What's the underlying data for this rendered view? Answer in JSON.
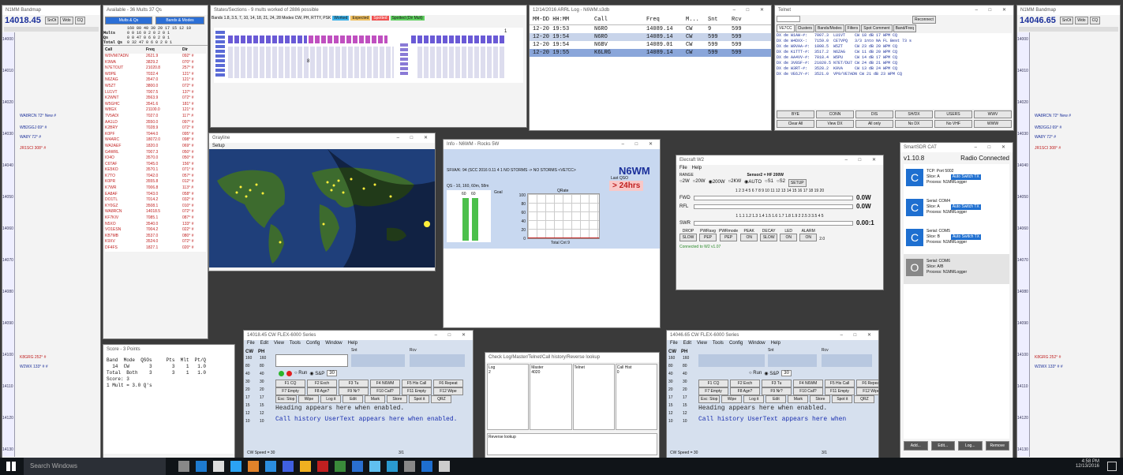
{
  "left_bandmap": {
    "title": "N1MM Bandmap",
    "freq": "14018.45",
    "buttons": [
      "SnOt",
      "Wdo",
      "CQ"
    ],
    "ticks": [
      "14000",
      "14010",
      "14020",
      "14030",
      "14040",
      "14050",
      "14060",
      "14070",
      "14080",
      "14090",
      "14100",
      "14110",
      "14120",
      "14130"
    ],
    "spots": [
      {
        "text": "WA8RCN 72° New #",
        "red": false
      },
      {
        "text": "WB2GGJ 69° #",
        "red": false
      },
      {
        "text": "WA8Y 72° #",
        "red": false
      },
      {
        "text": "JR1SCI 308° #",
        "red": true
      },
      {
        "text": "K8GRG 252° #",
        "red": true
      },
      {
        "text": "W2WX 133° # #",
        "red": false
      }
    ]
  },
  "available": {
    "title": "Available - 36 Mults 37 Qs",
    "buttons": [
      "Mults & Qs",
      "Bands & Modes"
    ],
    "header": "160 80 40 30 20 17 15 12 10",
    "rows": [
      {
        "label": "Mults",
        "vals": "0 0 16 0 2 0 2 0 1"
      },
      {
        "label": "Qs",
        "vals": "0 0 47 0 6 0 2 0 1"
      },
      {
        "label": "Total Qs",
        "vals": "0 32 47 0 6 0 2 0 1"
      }
    ],
    "list_headers": [
      "Call",
      "Freq",
      "Dir"
    ],
    "list": [
      [
        "W9VM/7ADN",
        "2621.9",
        "092° #"
      ],
      [
        "K9WA",
        "3829.2",
        "070° #"
      ],
      [
        "N7ETOUT",
        "21020.8",
        "257° #"
      ],
      [
        "W0PE",
        "7032.4",
        "121° #"
      ],
      [
        "N6ZAG",
        "3547.0",
        "121° #"
      ],
      [
        "W5ZT",
        "3800.0",
        "072° #"
      ],
      [
        "LU1VT",
        "7007.5",
        "137° #"
      ],
      [
        "K2WNT",
        "3563.9",
        "072° #"
      ],
      [
        "W5GHC",
        "3541.6",
        "181° #"
      ],
      [
        "W8GX",
        "21100.0",
        "121° #"
      ],
      [
        "7V5ADI",
        "7027.0",
        "117° #"
      ],
      [
        "AA1LD",
        "3550.0",
        "097° #"
      ],
      [
        "K2BRY",
        "7028.9",
        "072° #"
      ],
      [
        "K0PF",
        "7044.0",
        "095° #"
      ],
      [
        "W4ARC",
        "18072.0",
        "098° #"
      ],
      [
        "WA2AEF",
        "1820.0",
        "069° #"
      ],
      [
        "G4WRL",
        "7007.3",
        "050° #"
      ],
      [
        "IO4O",
        "3570.0",
        "050° #"
      ],
      [
        "C6TAF",
        "7045.0",
        "156° #"
      ],
      [
        "KE5KO",
        "3570.1",
        "071° #"
      ],
      [
        "K7TO",
        "7042.0",
        "057° #"
      ],
      [
        "K0PR",
        "3555.8",
        "012° #"
      ],
      [
        "K7WR",
        "7006.8",
        "113° #"
      ],
      [
        "EA8AF",
        "7043.0",
        "058° #"
      ],
      [
        "DO1TL",
        "7014.2",
        "032° #"
      ],
      [
        "KY0GZ",
        "3508.1",
        "010° #"
      ],
      [
        "WA8RCN",
        "14018.5",
        "072° #"
      ],
      [
        "KF7KIV",
        "7085.1",
        "087° #"
      ],
      [
        "N5XO",
        "3540.0",
        "133° #"
      ],
      [
        "VO1ESN",
        "7004.2",
        "022° #"
      ],
      [
        "KB7MB",
        "3537.0",
        "080° #"
      ],
      [
        "K9XV",
        "3524.0",
        "072° #"
      ],
      [
        "DF4FS",
        "1827.1",
        "020° #"
      ]
    ]
  },
  "states": {
    "title": "States/Sections - 9 mults worked of 2886 possible",
    "filter": "Bands 1.8, 3.5, 7, 10, 14, 18, 21, 24, 28 Modes CW, PH, RTTY, PSK",
    "legend": [
      "Worked",
      "Expected",
      "Spotted",
      "Spotted (Dir Mult)"
    ],
    "count": "8",
    "count2": "1"
  },
  "log": {
    "title": "12/14/2016 ARRL Log - N6WM.s3db",
    "headers": [
      "MM-DD HH:MM",
      "Call",
      "Freq",
      "M...",
      "Snt",
      "Rcv"
    ],
    "rows": [
      [
        "12-20 19:53",
        "N6RO",
        "14089.14",
        "CW",
        "9",
        "599"
      ],
      [
        "12-20 19:54",
        "N6RO",
        "14089.14",
        "CW",
        "599",
        "599"
      ],
      [
        "12-20 19:54",
        "N6BV",
        "14089.01",
        "CW",
        "599",
        "599"
      ],
      [
        "12-20 19:55",
        "K6LRG",
        "14089.14",
        "CW",
        "599",
        "599"
      ]
    ]
  },
  "telnet": {
    "title": "Telnet",
    "reconnect": "Reconnect",
    "tabs": [
      "VE7CC",
      "Clusters",
      "Bands/Modes",
      "Filters",
      "Spot Comment",
      "Band/Freq"
    ],
    "rows": [
      "DX de W1AW-#:   7007.3  LU1VT    CW 18 dB 17 WPM CQ",
      "DX de W4DXX-:   7159.0  CE7VPQ   3/3 into NA FL Best 73 s",
      "DX de W9VAA-#:  1808.5  W5ZT     CW 23 dB 20 WPM CQ",
      "DX de K1TTT-#:  3517.2  N6ZAG    CW 11 dB 20 WPM CQ",
      "DX de AA4VV-#:  7018.4  W5PU     CW 14 dB 17 WPM CQ",
      "DX de 3V8SF-#:  21020.5 N7ET/DU7 CW 24 dB 21 WPM CQ",
      "DX de W3RT-#:   3528.2  K9VA     CW 13 dB 24 WPM CQ",
      "DX de VE6JY-#:  3521.0  VP9/VE7ADN CW 21 dB 23 WPM CQ"
    ],
    "buttons_r1": [
      "BYE",
      "CONN",
      "DIS",
      "SH/DX",
      "USERS",
      "WWV"
    ],
    "buttons_r2": [
      "Clear All",
      "View DX",
      "All only",
      "No DX",
      "No VHF",
      "WWW"
    ]
  },
  "right_bandmap": {
    "title": "N1MM Bandmap",
    "freq": "14046.65",
    "buttons": [
      "SnOt",
      "Wdo",
      "CQ"
    ],
    "ticks": [
      "14000",
      "14010",
      "14020",
      "14030",
      "14040",
      "14050",
      "14060",
      "14070",
      "14080",
      "14090",
      "14100",
      "14110",
      "14120",
      "14130"
    ],
    "spots": [
      {
        "text": "WA8RCN 72° New #",
        "red": false
      },
      {
        "text": "WB2GGJ 69° #",
        "red": false
      },
      {
        "text": "WA8Y 72° #",
        "red": false
      },
      {
        "text": "JR1SCI 308° #",
        "red": true
      },
      {
        "text": "K8GRG 252° #",
        "red": true
      },
      {
        "text": "W2WX 133° # #",
        "red": false
      }
    ]
  },
  "map": {
    "title": "Grayline",
    "menu": "Setup"
  },
  "info": {
    "title": "Info - N6WM - Rocks 5W",
    "status": "SFI/A/K: 94 (SCC 2016 0.11 4 1 NO STORMS -> NO STORMS <VE7CC>",
    "callsign": "N6WM",
    "last_qso_label": "Last QSO",
    "last_qso": "> 24hrs",
    "chart1_title": "QS - 10, 160, 60m, 58m",
    "chart1_labels": [
      "60",
      "60"
    ],
    "goal": "Goal",
    "qrate": "QRate",
    "yticks": [
      "100",
      "80",
      "60",
      "40",
      "20",
      "0"
    ],
    "total": "Total Cnt 9"
  },
  "wattmeter": {
    "title": "Elecraft W2",
    "menu": [
      "File",
      "Help"
    ],
    "range_label": "RANGE",
    "sensor": "Sensor2 = HF 200W",
    "ranges": [
      "2W",
      "20W",
      "200W",
      "2KW",
      "AUTO",
      "S1",
      "S2"
    ],
    "setup": "SETUP",
    "scale_top": "1 2 3 4 5 6 7 8 9 10 11 12 13 14 15 16 17 18 19 20",
    "fwd_label": "FWD",
    "fwd_val": "0.0W",
    "rfl_label": "RFL",
    "rfl_val": "0.0W",
    "scale_swr": "1 1.1 1.2 1.3 1.4 1.5 1.6 1.7 1.8 1.9 2 2.5 3 3.5 4 5",
    "swr_label": "SWR",
    "swr_val": "0.00:1",
    "ctrl_headers": [
      "DROP",
      "PWRavg",
      "PWRmode",
      "PEAK",
      "DECAY",
      "LED",
      "ALARM"
    ],
    "ctrl_vals": [
      "SLOW",
      "PEP",
      "PEP",
      "ON",
      "SLOW",
      "ON",
      "ON"
    ],
    "alarm_val": "2.0",
    "connected": "Connected to W2 v1.07"
  },
  "smartsdr": {
    "title": "SmartSDR CAT",
    "version": "v1.10.8",
    "status": "Radio Connected",
    "items": [
      {
        "icon": "C",
        "line1": "TCP: Port 5002",
        "line2": "Slice: A",
        "line3": "Process: N1MMLogger",
        "tag": "Auto Switch TX"
      },
      {
        "icon": "C",
        "line1": "Serial: COM4",
        "line2": "Slice: A",
        "line3": "Process: N1MMLogger",
        "tag": "Auto Switch TX"
      },
      {
        "icon": "C",
        "line1": "Serial: COM5",
        "line2": "Slice: B",
        "line3": "Process: N1MMLogger",
        "tag": "Auto Switch TX"
      },
      {
        "icon": "O",
        "line1": "Serial: COM6",
        "line2": "Slice: A/B",
        "line3": "Process: N1MMLogger",
        "tag": ""
      }
    ],
    "buttons": [
      "Add...",
      "Edit...",
      "Log...",
      "Remove"
    ]
  },
  "score": {
    "title": "Score - 3 Points",
    "lines": [
      "Band  Mode  QSOs     Pts  Mlt  Pt/Q",
      "  14  CW       3       3    1   1.0",
      "Total  Both    3       3    1   1.0",
      "Score: 3",
      "1 Mult = 3.0 Q's"
    ]
  },
  "entry1": {
    "title": "14018.45 CW FLEX-6000 Series",
    "menu": [
      "File",
      "Edit",
      "View",
      "Tools",
      "Config",
      "Window",
      "Help"
    ],
    "cols": [
      "CW",
      "PH"
    ],
    "snt": "Snt",
    "rcv": "Rcv",
    "run": "Run",
    "sp": "S&P",
    "spin": "30",
    "fkeys1": [
      "F1 CQ",
      "F2 Exch",
      "F3 Tu",
      "F4 N6WM",
      "F5 His Call",
      "F6 Repeat"
    ],
    "fkeys2": [
      "F7 Empty",
      "F8 Agn?",
      "F9 Nr?",
      "F10 Call?",
      "F11 Empty",
      "F12 Wipe"
    ],
    "buttons": [
      "Esc: Stop",
      "Wipe",
      "Log it",
      "Edit",
      "Mark",
      "Store",
      "Spot it",
      "QRZ"
    ],
    "msg1": "Heading appears here when enabled.",
    "msg2": "Call history UserText appears here when enabled.",
    "speed": "CW Speed = 30",
    "pages": "3/1",
    "left_nums": [
      [
        "160",
        "160"
      ],
      [
        "80",
        "80"
      ],
      [
        "40",
        "40"
      ],
      [
        "30",
        "30"
      ],
      [
        "20",
        "20"
      ],
      [
        "17",
        "17"
      ],
      [
        "15",
        "15"
      ],
      [
        "12",
        "12"
      ],
      [
        "10",
        "10"
      ]
    ]
  },
  "check": {
    "title": "Check Log/Master/Telnet/Call history/Reverse lookup",
    "headers": [
      "Log",
      "Master",
      "Telnet",
      "Call Hist"
    ],
    "vals": [
      "2",
      "4020",
      "",
      "0"
    ],
    "reverse": "Reverse lookup"
  },
  "entry2": {
    "title": "14046.65 CW FLEX-6000 Series",
    "menu": [
      "File",
      "Edit",
      "View",
      "Tools",
      "Config",
      "Window",
      "Help"
    ],
    "cols": [
      "CW",
      "PH"
    ],
    "snt": "Snt",
    "rcv": "Rcv",
    "run": "Run",
    "sp": "S&P",
    "spin": "30",
    "fkeys1": [
      "F1 CQ",
      "F2 Exch",
      "F3 Tu",
      "F4 N6WM",
      "F5 His Call",
      "F6 Repeat"
    ],
    "fkeys2": [
      "F7 Empty",
      "F8 Agn?",
      "F9 Nr?",
      "F10 Call?",
      "F11 Empty",
      "F12 Wipe"
    ],
    "buttons": [
      "Esc: Stop",
      "Wipe",
      "Log it",
      "Edit",
      "Mark",
      "Store",
      "Spot it",
      "QRZ"
    ],
    "msg1": "Heading appears here when enabled.",
    "msg2": "Call history UserText appears here when",
    "speed": "CW Speed = 30",
    "pages": "3/1",
    "left_nums": [
      [
        "160",
        "160"
      ],
      [
        "80",
        "80"
      ],
      [
        "40",
        "40"
      ],
      [
        "30",
        "30"
      ],
      [
        "20",
        "20"
      ],
      [
        "17",
        "17"
      ],
      [
        "15",
        "15"
      ],
      [
        "12",
        "12"
      ],
      [
        "10",
        "10"
      ]
    ]
  },
  "taskbar": {
    "search": "Search Windows",
    "time": "4:58 PM",
    "date": "12/13/2016"
  }
}
